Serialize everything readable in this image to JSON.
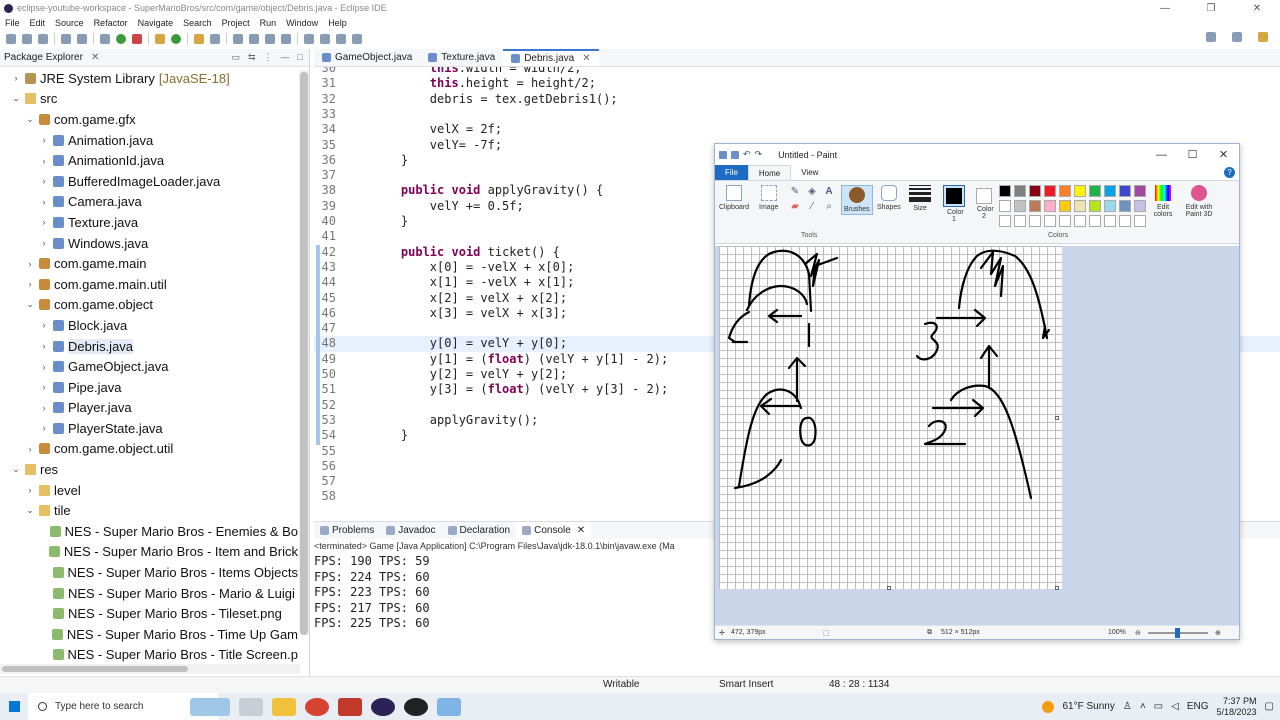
{
  "window": {
    "title": "eclipse-youtube-workspace - SuperMarioBros/src/com/game/object/Debris.java - Eclipse IDE"
  },
  "menu": [
    "File",
    "Edit",
    "Source",
    "Refactor",
    "Navigate",
    "Search",
    "Project",
    "Run",
    "Window",
    "Help"
  ],
  "package_explorer": {
    "title": "Package Explorer",
    "items": [
      {
        "indent": 1,
        "arrow": "›",
        "icon": "jar",
        "label": "JRE System Library",
        "extra": "[JavaSE-18]"
      },
      {
        "indent": 1,
        "arrow": "⌄",
        "icon": "folder",
        "label": "src"
      },
      {
        "indent": 2,
        "arrow": "⌄",
        "icon": "pkg",
        "label": "com.game.gfx"
      },
      {
        "indent": 3,
        "arrow": "›",
        "icon": "java",
        "label": "Animation.java"
      },
      {
        "indent": 3,
        "arrow": "›",
        "icon": "java",
        "label": "AnimationId.java"
      },
      {
        "indent": 3,
        "arrow": "›",
        "icon": "java",
        "label": "BufferedImageLoader.java"
      },
      {
        "indent": 3,
        "arrow": "›",
        "icon": "java",
        "label": "Camera.java"
      },
      {
        "indent": 3,
        "arrow": "›",
        "icon": "java",
        "label": "Texture.java"
      },
      {
        "indent": 3,
        "arrow": "›",
        "icon": "java",
        "label": "Windows.java"
      },
      {
        "indent": 2,
        "arrow": "›",
        "icon": "pkg",
        "label": "com.game.main"
      },
      {
        "indent": 2,
        "arrow": "›",
        "icon": "pkg",
        "label": "com.game.main.util"
      },
      {
        "indent": 2,
        "arrow": "⌄",
        "icon": "pkg",
        "label": "com.game.object"
      },
      {
        "indent": 3,
        "arrow": "›",
        "icon": "java",
        "label": "Block.java"
      },
      {
        "indent": 3,
        "arrow": "›",
        "icon": "java",
        "label": "Debris.java",
        "selected": true
      },
      {
        "indent": 3,
        "arrow": "›",
        "icon": "java",
        "label": "GameObject.java"
      },
      {
        "indent": 3,
        "arrow": "›",
        "icon": "java",
        "label": "Pipe.java"
      },
      {
        "indent": 3,
        "arrow": "›",
        "icon": "java",
        "label": "Player.java"
      },
      {
        "indent": 3,
        "arrow": "›",
        "icon": "java",
        "label": "PlayerState.java"
      },
      {
        "indent": 2,
        "arrow": "›",
        "icon": "pkg",
        "label": "com.game.object.util"
      },
      {
        "indent": 1,
        "arrow": "⌄",
        "icon": "folder",
        "label": "res"
      },
      {
        "indent": 2,
        "arrow": "›",
        "icon": "folder",
        "label": "level"
      },
      {
        "indent": 2,
        "arrow": "⌄",
        "icon": "folder",
        "label": "tile"
      },
      {
        "indent": 3,
        "arrow": "",
        "icon": "img",
        "label": "NES - Super Mario Bros - Enemies & Bo"
      },
      {
        "indent": 3,
        "arrow": "",
        "icon": "img",
        "label": "NES - Super Mario Bros - Item and Brick"
      },
      {
        "indent": 3,
        "arrow": "",
        "icon": "img",
        "label": "NES - Super Mario Bros - Items Objects"
      },
      {
        "indent": 3,
        "arrow": "",
        "icon": "img",
        "label": "NES - Super Mario Bros - Mario & Luigi"
      },
      {
        "indent": 3,
        "arrow": "",
        "icon": "img",
        "label": "NES - Super Mario Bros - Tileset.png"
      },
      {
        "indent": 3,
        "arrow": "",
        "icon": "img",
        "label": "NES - Super Mario Bros - Time Up Gam"
      },
      {
        "indent": 3,
        "arrow": "",
        "icon": "img",
        "label": "NES - Super Mario Bros - Title Screen.p"
      }
    ]
  },
  "editor": {
    "tabs": [
      {
        "label": "GameObject.java",
        "active": false
      },
      {
        "label": "Texture.java",
        "active": false
      },
      {
        "label": "Debris.java",
        "active": true
      }
    ],
    "lines": [
      {
        "n": "30",
        "code": "        this.width = width/2;"
      },
      {
        "n": "31",
        "code": "        this.height = height/2;"
      },
      {
        "n": "32",
        "code": "        debris = tex.getDebris1();"
      },
      {
        "n": "33",
        "code": ""
      },
      {
        "n": "34",
        "code": "        velX = 2f;"
      },
      {
        "n": "35",
        "code": "        velY= -7f;"
      },
      {
        "n": "36",
        "code": "    }"
      },
      {
        "n": "37",
        "code": ""
      },
      {
        "n": "38",
        "code": "    public void applyGravity() {"
      },
      {
        "n": "39",
        "code": "        velY += 0.5f;"
      },
      {
        "n": "40",
        "code": "    }"
      },
      {
        "n": "41",
        "code": ""
      },
      {
        "n": "42",
        "code": "    public void ticket() {"
      },
      {
        "n": "43",
        "code": "        x[0] = -velX + x[0];"
      },
      {
        "n": "44",
        "code": "        x[1] = -velX + x[1];"
      },
      {
        "n": "45",
        "code": "        x[2] = velX + x[2];"
      },
      {
        "n": "46",
        "code": "        x[3] = velX + x[3];"
      },
      {
        "n": "47",
        "code": ""
      },
      {
        "n": "48",
        "code": "        y[0] = velY + y[0];"
      },
      {
        "n": "49",
        "code": "        y[1] = (float) (velY + y[1] - 2);"
      },
      {
        "n": "50",
        "code": "        y[2] = velY + y[2];"
      },
      {
        "n": "51",
        "code": "        y[3] = (float) (velY + y[3] - 2);"
      },
      {
        "n": "52",
        "code": ""
      },
      {
        "n": "53",
        "code": "        applyGravity();"
      },
      {
        "n": "54",
        "code": "    }"
      },
      {
        "n": "55",
        "code": ""
      },
      {
        "n": "56",
        "code": ""
      },
      {
        "n": "57",
        "code": ""
      },
      {
        "n": "58",
        "code": ""
      }
    ],
    "current_line": "48"
  },
  "console": {
    "tabs": [
      {
        "label": "Problems",
        "active": false
      },
      {
        "label": "Javadoc",
        "active": false
      },
      {
        "label": "Declaration",
        "active": false
      },
      {
        "label": "Console",
        "active": true
      }
    ],
    "status": "<terminated> Game [Java Application] C:\\Program Files\\Java\\jdk-18.0.1\\bin\\javaw.exe  (Ma",
    "lines": [
      "FPS: 190 TPS: 59",
      "FPS: 224 TPS: 60",
      "FPS: 223 TPS: 60",
      "FPS: 217 TPS: 60",
      "FPS: 225 TPS: 60"
    ]
  },
  "statusbar": {
    "mode": "Writable",
    "insert": "Smart Insert",
    "position": "48 : 28 : 1134"
  },
  "paint": {
    "title": "Untitled - Paint",
    "tabs": {
      "file": "File",
      "home": "Home",
      "view": "View"
    },
    "ribbon": {
      "clipboard": "Clipboard",
      "image": "Image",
      "tools": "Tools",
      "brushes": "Brushes",
      "shapes": "Shapes",
      "size": "Size",
      "color1": "Color 1",
      "color2": "Color 2",
      "colors": "Colors",
      "edit_colors": "Edit colors",
      "edit_3d": "Edit with Paint 3D"
    },
    "palette": [
      "#000000",
      "#7f7f7f",
      "#880015",
      "#ed1c24",
      "#ff7f27",
      "#fff200",
      "#22b14c",
      "#00a2e8",
      "#3f48cc",
      "#a349a4",
      "#ffffff",
      "#c3c3c3",
      "#b97a57",
      "#ffaec9",
      "#ffc90e",
      "#efe4b0",
      "#b5e61d",
      "#99d9ea",
      "#7092be",
      "#c8bfe7",
      "#ffffff",
      "#ffffff",
      "#ffffff",
      "#ffffff",
      "#ffffff",
      "#ffffff",
      "#ffffff",
      "#ffffff",
      "#ffffff",
      "#ffffff"
    ],
    "status": {
      "cursor": "472, 379px",
      "size": "512 × 512px",
      "zoom": "100%"
    }
  },
  "taskbar": {
    "search_placeholder": "Type here to search",
    "weather": "61°F  Sunny",
    "lang": "ENG",
    "time": "7:37 PM",
    "date": "5/18/2023"
  }
}
